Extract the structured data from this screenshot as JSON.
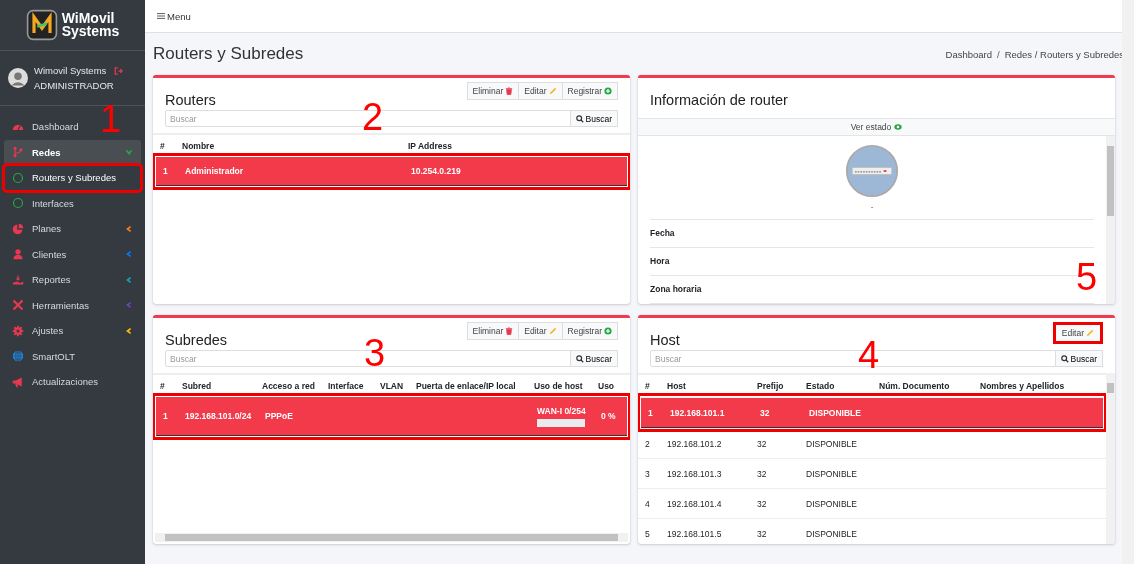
{
  "sidebar": {
    "brand": [
      "WiMovil",
      "Systems"
    ],
    "user": {
      "name": "Wimovil Systems",
      "role": "ADMINISTRADOR"
    },
    "items": [
      {
        "label": "Dashboard",
        "kind": "gauge",
        "selected": false
      },
      {
        "label": "Redes",
        "kind": "branch",
        "selected": true,
        "expanded": true,
        "color": "#28a745",
        "children": [
          {
            "label": "Routers y Subredes",
            "selected": true,
            "highlighted": true
          },
          {
            "label": "Interfaces",
            "selected": false,
            "highlighted": false
          }
        ]
      },
      {
        "label": "Planes",
        "kind": "pie",
        "selected": false,
        "expanded": false,
        "color": "#fd7e14"
      },
      {
        "label": "Clientes",
        "kind": "user",
        "selected": false,
        "expanded": false,
        "color": "#007bff"
      },
      {
        "label": "Reportes",
        "kind": "hand",
        "selected": false,
        "expanded": false,
        "color": "#17a2b8"
      },
      {
        "label": "Herramientas",
        "kind": "tools",
        "selected": false,
        "expanded": false,
        "color": "#6f42c1"
      },
      {
        "label": "Ajustes",
        "kind": "gear",
        "selected": false,
        "expanded": false,
        "color": "#ffc107"
      },
      {
        "label": "SmartOLT",
        "kind": "globe",
        "selected": false
      },
      {
        "label": "Actualizaciones",
        "kind": "megaphone",
        "selected": false
      }
    ]
  },
  "topbar": {
    "menu": "Menu"
  },
  "page_title": "Routers y Subredes",
  "breadcrumb": {
    "items": [
      "Dashboard",
      "Redes / Routers y Subredes"
    ],
    "separator": "/"
  },
  "routers": {
    "title": "Routers",
    "buttons": [
      {
        "label": "Eliminar",
        "kind": "delete"
      },
      {
        "label": "Editar",
        "kind": "edit"
      },
      {
        "label": "Registrar",
        "kind": "add"
      }
    ],
    "search": {
      "placeholder": "Buscar",
      "button": "Buscar"
    },
    "columns": [
      "#",
      "Nombre",
      "IP Address"
    ],
    "rows": [
      {
        "cells": [
          "1",
          "Administrador",
          "10.254.0.219"
        ],
        "selected": true,
        "highlighted": true
      }
    ]
  },
  "subnets": {
    "title": "Subredes",
    "buttons": [
      {
        "label": "Eliminar",
        "kind": "delete"
      },
      {
        "label": "Editar",
        "kind": "edit"
      },
      {
        "label": "Registrar",
        "kind": "add"
      }
    ],
    "search": {
      "placeholder": "Buscar",
      "button": "Buscar"
    },
    "columns": [
      "#",
      "Subred",
      "Acceso a red",
      "Interface",
      "VLAN",
      "Puerta de enlace/IP local",
      "Uso de host",
      "Uso"
    ],
    "rows": [
      {
        "number": "1",
        "subnet": "192.168.101.0/24",
        "access": "PPPoE",
        "interface": "",
        "vlan": "",
        "gateway": "",
        "usage_text": "WAN-I 0/254",
        "level": 0,
        "usage_percent": "0 %",
        "selected": true,
        "highlighted": true
      }
    ]
  },
  "router_info": {
    "title": "Información de router",
    "status_link": "Ver estado",
    "device_caption": "-",
    "fields": [
      "Fecha",
      "Hora",
      "Zona horaria"
    ]
  },
  "hosts": {
    "title": "Host",
    "buttons": [
      {
        "label": "Editar",
        "kind": "edit",
        "highlighted": true
      }
    ],
    "search": {
      "placeholder": "Buscar",
      "button": "Buscar"
    },
    "columns": [
      "#",
      "Host",
      "Prefijo",
      "Estado",
      "Núm. Documento",
      "Nombres y Apellidos"
    ],
    "rows": [
      {
        "cells": [
          "1",
          "192.168.101.1",
          "32",
          "DISPONIBLE"
        ],
        "selected": true,
        "highlighted": true
      },
      {
        "cells": [
          "2",
          "192.168.101.2",
          "32",
          "DISPONIBLE"
        ],
        "selected": false,
        "highlighted": false
      },
      {
        "cells": [
          "3",
          "192.168.101.3",
          "32",
          "DISPONIBLE"
        ],
        "selected": false,
        "highlighted": false
      },
      {
        "cells": [
          "4",
          "192.168.101.4",
          "32",
          "DISPONIBLE"
        ],
        "selected": false,
        "highlighted": false
      },
      {
        "cells": [
          "5",
          "192.168.101.5",
          "32",
          "DISPONIBLE"
        ],
        "selected": false,
        "highlighted": false
      }
    ]
  },
  "callouts": [
    "1",
    "2",
    "3",
    "4",
    "5"
  ]
}
